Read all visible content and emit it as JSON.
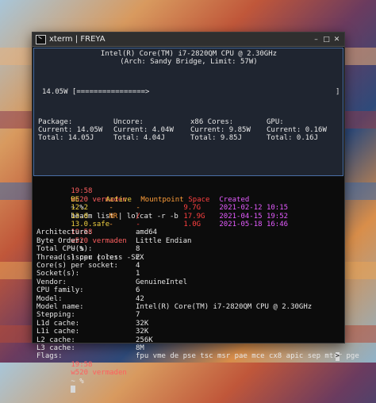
{
  "window": {
    "title": "xterm | FREYA",
    "buttons": {
      "minimize": "–",
      "maximize": "□",
      "close": "✕"
    }
  },
  "power_pane": {
    "cpu_name": "Intel(R) Core(TM) i7-2820QM CPU @ 2.30GHz",
    "cpu_arch": "(Arch: Sandy Bridge, Limit: 57W)",
    "bar": "14.05W [================>",
    "bar_end": "]",
    "stats": [
      {
        "label": "Package:",
        "current": "Current: 14.05W",
        "total": "Total: 14.05J"
      },
      {
        "label": "Uncore:",
        "current": "Current: 4.04W",
        "total": "Total: 4.04J"
      },
      {
        "label": "x86 Cores:",
        "current": "Current: 9.85W",
        "total": "Total: 9.85J"
      },
      {
        "label": "GPU:",
        "current": "Current: 0.16W",
        "total": "Total: 0.16J"
      }
    ]
  },
  "prompt": {
    "time": "19:58",
    "user": "w520 vermaden",
    "sign": "~ %"
  },
  "commands": {
    "beadm": "beadm list | lolcat -r -b",
    "lscpu": "lscpu | less -SEX"
  },
  "beadm_table": {
    "headers": [
      "BE",
      "Active",
      "Mountpoint",
      "Space",
      "Created"
    ],
    "rows": [
      [
        "12.2",
        "-",
        "-",
        "9.7G",
        "2021-02-12 10:15"
      ],
      [
        "13.0",
        "NR",
        "/",
        "17.9G",
        "2021-04-15 19:52"
      ],
      [
        "13.0.safe",
        "-",
        "-",
        "1.0G",
        "2021-05-18 16:46"
      ]
    ]
  },
  "lscpu_rows": [
    [
      "Architecture:",
      "amd64"
    ],
    [
      "Byte Order:",
      "Little Endian"
    ],
    [
      "Total CPU(s):",
      "8"
    ],
    [
      "Thread(s) per core:",
      "2"
    ],
    [
      "Core(s) per socket:",
      "4"
    ],
    [
      "Socket(s):",
      "1"
    ],
    [
      "Vendor:",
      "GenuineIntel"
    ],
    [
      "CPU family:",
      "6"
    ],
    [
      "Model:",
      "42"
    ],
    [
      "Model name:",
      "Intel(R) Core(TM) i7-2820QM CPU @ 2.30GHz"
    ],
    [
      "Stepping:",
      "7"
    ],
    [
      "L1d cache:",
      "32K"
    ],
    [
      "L1i cache:",
      "32K"
    ],
    [
      "L2 cache:",
      "256K"
    ],
    [
      "L3 cache:",
      "8M"
    ],
    [
      "Flags:",
      "fpu vme de pse tsc msr pae mce cx8 apic sep mtrr pge"
    ]
  ],
  "scroll_indicator": ">"
}
